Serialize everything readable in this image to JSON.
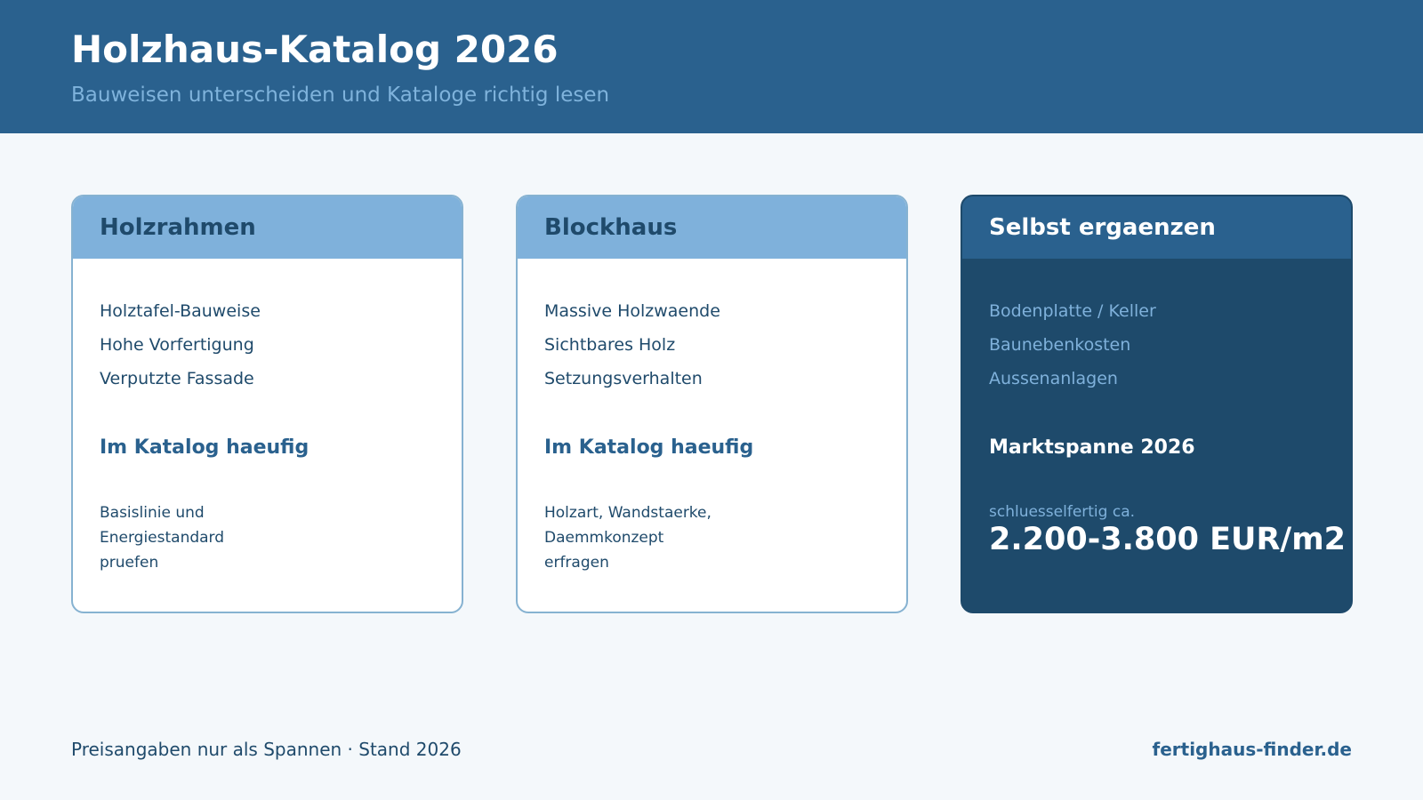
{
  "header": {
    "title": "Holzhaus-Katalog 2026",
    "subtitle": "Bauweisen unterscheiden und Kataloge richtig lesen"
  },
  "cards": [
    {
      "title": "Holzrahmen",
      "items": [
        "Holztafel-Bauweise",
        "Hohe Vorfertigung",
        "Verputzte Fassade"
      ],
      "section_title": "Im Katalog haeufig",
      "note_lines": [
        "Basislinie und",
        "Energiestandard",
        "pruefen"
      ]
    },
    {
      "title": "Blockhaus",
      "items": [
        "Massive Holzwaende",
        "Sichtbares Holz",
        "Setzungsverhalten"
      ],
      "section_title": "Im Katalog haeufig",
      "note_lines": [
        "Holzart, Wandstaerke,",
        "Daemmkonzept",
        "erfragen"
      ]
    },
    {
      "title": "Selbst ergaenzen",
      "items": [
        "Bodenplatte / Keller",
        "Baunebenkosten",
        "Aussenanlagen"
      ],
      "section_title": "Marktspanne 2026",
      "price_label": "schluesselfertig ca.",
      "price_value": "2.200-3.800 EUR/m2"
    }
  ],
  "footer": {
    "note": "Preisangaben nur als Spannen · Stand 2026",
    "site": "fertighaus-finder.de"
  },
  "colors": {
    "header_bg": "#2a618e",
    "card_head_light": "#7fb1db",
    "card_dark_bg": "#1e4a6b",
    "page_bg": "#f4f8fb"
  }
}
